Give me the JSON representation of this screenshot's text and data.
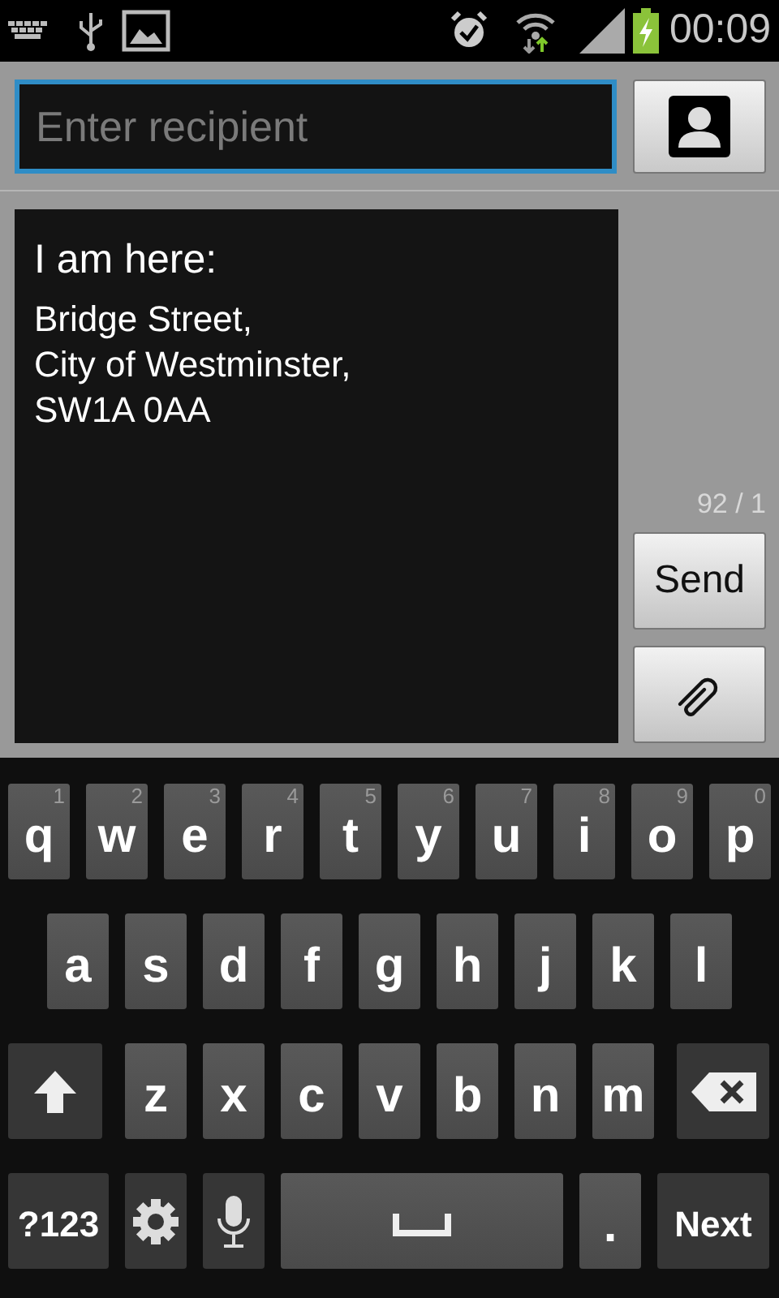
{
  "status_bar": {
    "time": "00:09"
  },
  "recipient": {
    "placeholder": "Enter recipient"
  },
  "message": {
    "title": "I am here:",
    "lines": [
      "Bridge Street,",
      "City of Westminster,",
      "SW1A 0AA"
    ]
  },
  "counter": "92 / 1",
  "send_button": "Send",
  "keyboard": {
    "rows": [
      [
        {
          "kind": "char",
          "label": "q",
          "hint": "1"
        },
        {
          "kind": "char",
          "label": "w",
          "hint": "2"
        },
        {
          "kind": "char",
          "label": "e",
          "hint": "3"
        },
        {
          "kind": "char",
          "label": "r",
          "hint": "4"
        },
        {
          "kind": "char",
          "label": "t",
          "hint": "5"
        },
        {
          "kind": "char",
          "label": "y",
          "hint": "6"
        },
        {
          "kind": "char",
          "label": "u",
          "hint": "7"
        },
        {
          "kind": "char",
          "label": "i",
          "hint": "8"
        },
        {
          "kind": "char",
          "label": "o",
          "hint": "9"
        },
        {
          "kind": "char",
          "label": "p",
          "hint": "0"
        }
      ],
      [
        {
          "kind": "char",
          "label": "a"
        },
        {
          "kind": "char",
          "label": "s"
        },
        {
          "kind": "char",
          "label": "d"
        },
        {
          "kind": "char",
          "label": "f"
        },
        {
          "kind": "char",
          "label": "g"
        },
        {
          "kind": "char",
          "label": "h"
        },
        {
          "kind": "char",
          "label": "j"
        },
        {
          "kind": "char",
          "label": "k"
        },
        {
          "kind": "char",
          "label": "l"
        }
      ],
      [
        {
          "kind": "shift"
        },
        {
          "kind": "char",
          "label": "z"
        },
        {
          "kind": "char",
          "label": "x"
        },
        {
          "kind": "char",
          "label": "c"
        },
        {
          "kind": "char",
          "label": "v"
        },
        {
          "kind": "char",
          "label": "b"
        },
        {
          "kind": "char",
          "label": "n"
        },
        {
          "kind": "char",
          "label": "m"
        },
        {
          "kind": "delete"
        }
      ]
    ],
    "bottom_row": [
      {
        "kind": "mode",
        "label": "?123"
      },
      {
        "kind": "settings"
      },
      {
        "kind": "mic"
      },
      {
        "kind": "space"
      },
      {
        "kind": "char",
        "label": "."
      },
      {
        "kind": "action",
        "label": "Next"
      }
    ]
  }
}
